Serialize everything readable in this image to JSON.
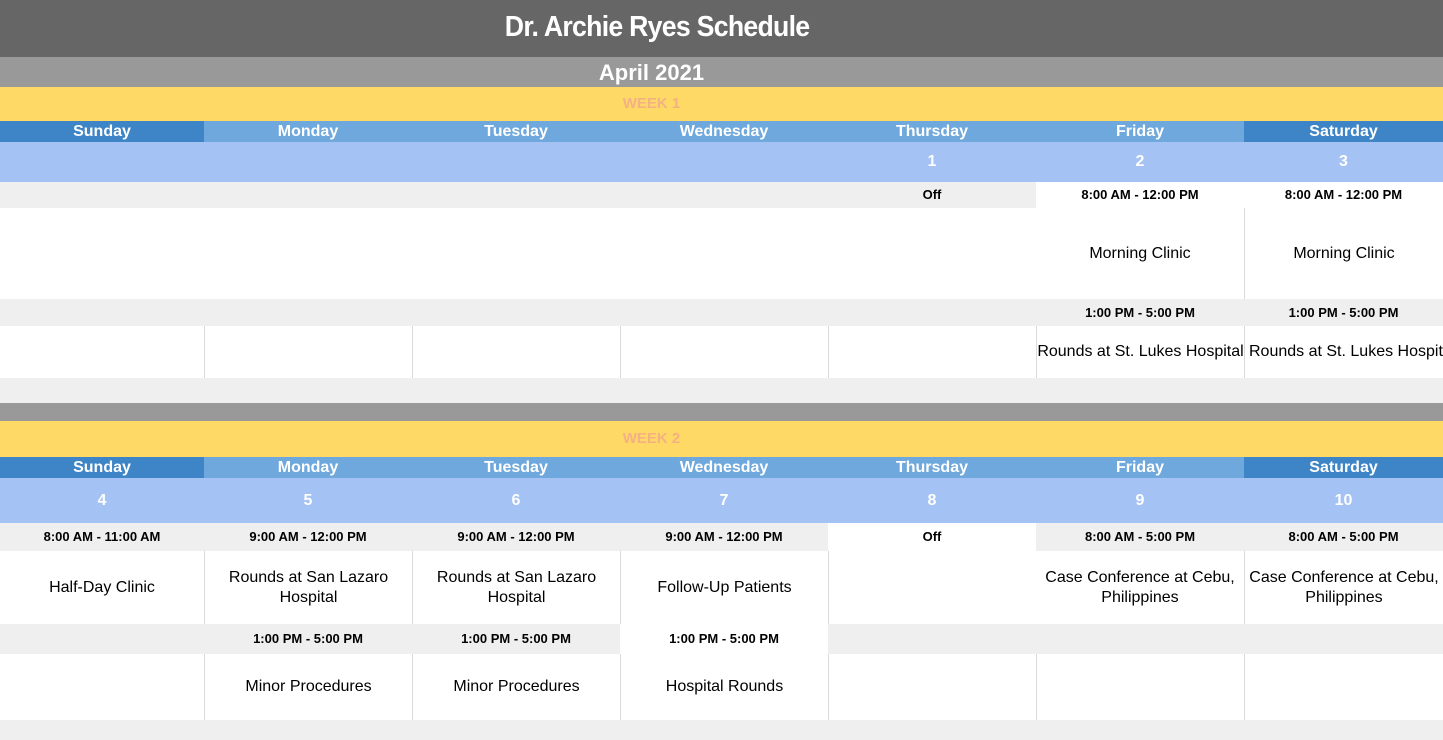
{
  "title": "Dr. Archie Ryes Schedule",
  "month": "April 2021",
  "weeks": [
    {
      "label": "WEEK 1",
      "days": [
        "Sunday",
        "Monday",
        "Tuesday",
        "Wednesday",
        "Thursday",
        "Friday",
        "Saturday"
      ],
      "dates": [
        "",
        "",
        "",
        "",
        "1",
        "2",
        "3"
      ],
      "am_times": [
        "",
        "",
        "",
        "",
        "Off",
        "8:00 AM - 12:00 PM",
        "8:00 AM - 12:00 PM"
      ],
      "am_events": [
        "",
        "",
        "",
        "",
        "",
        "Morning Clinic",
        "Morning Clinic"
      ],
      "pm_times": [
        "",
        "",
        "",
        "",
        "",
        "1:00 PM - 5:00 PM",
        "1:00 PM - 5:00 PM"
      ],
      "pm_events": [
        "",
        "",
        "",
        "",
        "",
        "Rounds at St. Lukes Hospital",
        "Rounds at St. Lukes Hospital"
      ]
    },
    {
      "label": "WEEK 2",
      "days": [
        "Sunday",
        "Monday",
        "Tuesday",
        "Wednesday",
        "Thursday",
        "Friday",
        "Saturday"
      ],
      "dates": [
        "4",
        "5",
        "6",
        "7",
        "8",
        "9",
        "10"
      ],
      "am_times": [
        "8:00 AM - 11:00 AM",
        "9:00 AM - 12:00 PM",
        "9:00 AM - 12:00 PM",
        "9:00 AM - 12:00 PM",
        "Off",
        "8:00 AM - 5:00 PM",
        "8:00 AM - 5:00 PM"
      ],
      "am_events": [
        "Half-Day Clinic",
        "Rounds at San Lazaro Hospital",
        "Rounds at San Lazaro Hospital",
        "Follow-Up Patients",
        "",
        "Case Conference at Cebu, Philippines",
        "Case Conference at Cebu, Philippines"
      ],
      "pm_times": [
        "",
        "1:00 PM - 5:00 PM",
        "1:00 PM - 5:00 PM",
        "1:00 PM - 5:00 PM",
        "",
        "",
        ""
      ],
      "pm_events": [
        "",
        "Minor Procedures",
        "Minor Procedures",
        "Hospital Rounds",
        "",
        "",
        ""
      ]
    }
  ],
  "colors": {
    "title_bg": "#666666",
    "month_bg": "#999999",
    "week_bg": "#ffd966",
    "week_text": "#f4b183",
    "weekday_bg": "#6fa8dc",
    "weekend_bg": "#3d85c6",
    "date_bg": "#a4c2f4",
    "time_bg": "#efefef"
  }
}
